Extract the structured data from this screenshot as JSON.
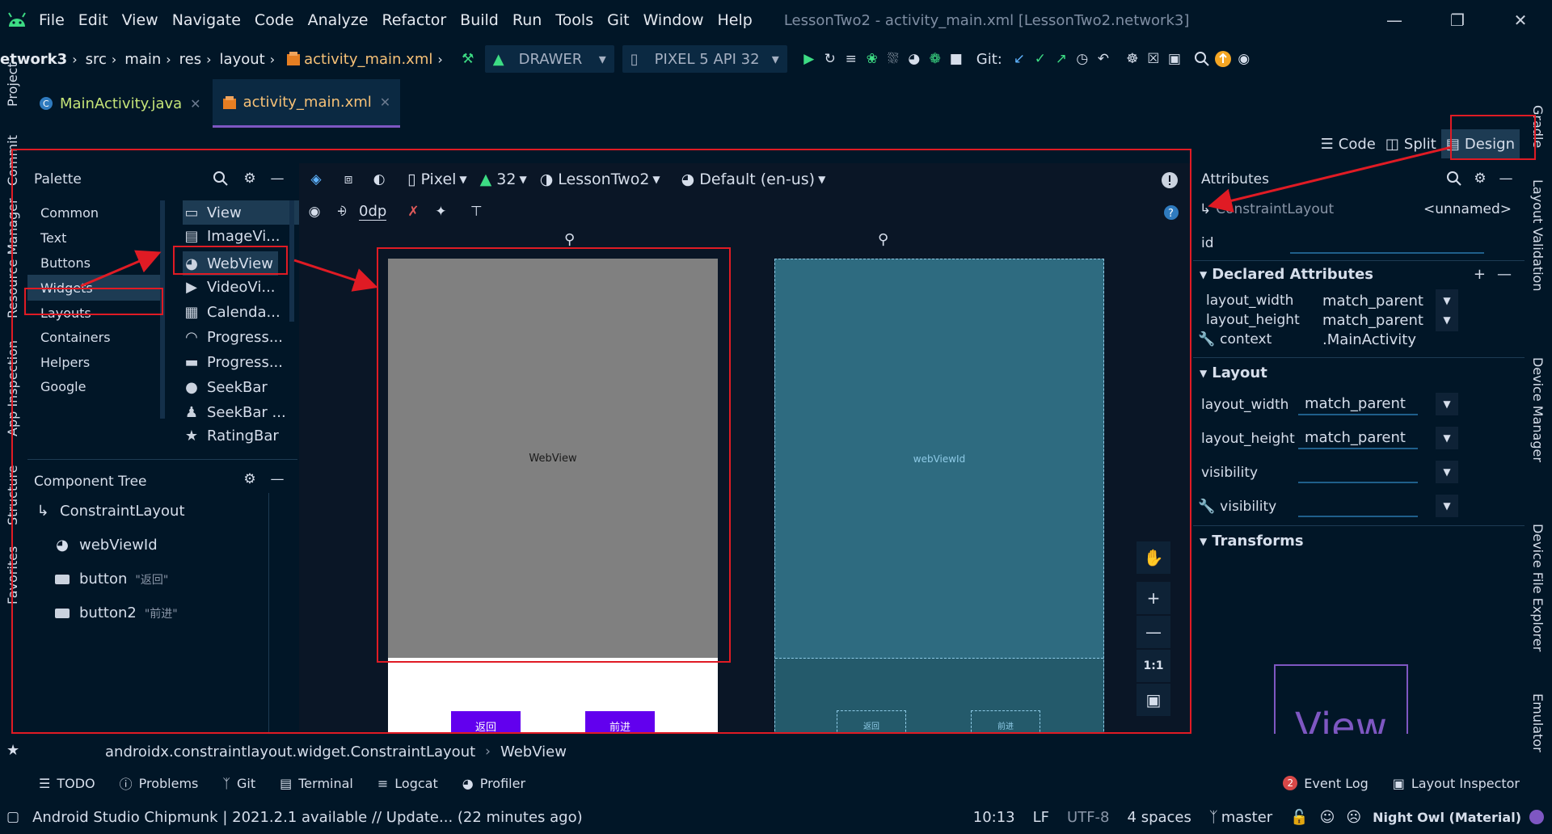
{
  "menu": {
    "items": [
      "File",
      "Edit",
      "View",
      "Navigate",
      "Code",
      "Analyze",
      "Refactor",
      "Build",
      "Run",
      "Tools",
      "Git",
      "Window",
      "Help"
    ],
    "window_title": "LessonTwo2 - activity_main.xml [LessonTwo2.network3]"
  },
  "nav": {
    "breadcrumbs": [
      "etwork3",
      "src",
      "main",
      "res",
      "layout",
      "activity_main.xml"
    ],
    "config_combo": "DRAWER",
    "device_combo": "PIXEL 5 API 32",
    "git_label": "Git:"
  },
  "tabs": [
    {
      "label": "MainActivity.java",
      "active": false
    },
    {
      "label": "activity_main.xml",
      "active": true
    }
  ],
  "left_strip": [
    "Project",
    "Commit",
    "Resource Manager",
    "App Inspection",
    "Structure",
    "Favorites"
  ],
  "right_strip": [
    "Gradle",
    "Layout Validation",
    "Device Manager",
    "Device File Explorer",
    "Emulator"
  ],
  "view_modes": {
    "code": "Code",
    "split": "Split",
    "design": "Design",
    "active": "Design"
  },
  "palette": {
    "title": "Palette",
    "categories": [
      "Common",
      "Text",
      "Buttons",
      "Widgets",
      "Layouts",
      "Containers",
      "Helpers",
      "Google"
    ],
    "selected_category": "Widgets",
    "widgets": [
      "View",
      "ImageVi...",
      "WebView",
      "VideoVi...",
      "Calenda...",
      "Progress...",
      "Progress...",
      "SeekBar",
      "SeekBar ...",
      "RatingBar"
    ],
    "selected_widget": "WebView"
  },
  "component_tree": {
    "title": "Component Tree",
    "nodes": [
      {
        "label": "ConstraintLayout",
        "hint": ""
      },
      {
        "label": "webViewId",
        "hint": ""
      },
      {
        "label": "button",
        "hint": "\"返回\""
      },
      {
        "label": "button2",
        "hint": "\"前进\""
      }
    ]
  },
  "surface": {
    "device": "Pixel",
    "api": "32",
    "theme": "LessonTwo2",
    "locale": "Default (en-us)",
    "margin": "0dp",
    "design_webview_label": "WebView",
    "blueprint_webview_label": "webViewId",
    "back_button": "返回",
    "forward_button": "前进",
    "zoom_fit": "1:1"
  },
  "attributes": {
    "title": "Attributes",
    "component": "ConstraintLayout",
    "component_name": "<unnamed>",
    "id_label": "id",
    "declared_title": "Declared Attributes",
    "declared": [
      {
        "name": "layout_width",
        "value": "match_parent"
      },
      {
        "name": "layout_height",
        "value": "match_parent"
      },
      {
        "name": "context",
        "value": ".MainActivity"
      }
    ],
    "layout_title": "Layout",
    "layout": [
      {
        "name": "layout_width",
        "value": "match_parent"
      },
      {
        "name": "layout_height",
        "value": "match_parent"
      },
      {
        "name": "visibility",
        "value": ""
      },
      {
        "name": "visibility",
        "value": ""
      }
    ],
    "transforms_title": "Transforms",
    "preview_label": "View"
  },
  "component_breadcrumb": [
    "androidx.constraintlayout.widget.ConstraintLayout",
    "WebView"
  ],
  "tool_windows": [
    "TODO",
    "Problems",
    "Git",
    "Terminal",
    "Logcat",
    "Profiler"
  ],
  "tool_windows_right": {
    "event_log": "Event Log",
    "event_count": "2",
    "layout_inspector": "Layout Inspector"
  },
  "status": {
    "message": "Android Studio Chipmunk | 2021.2.1 available // Update... (22 minutes ago)",
    "position": "10:13",
    "line_sep": "LF",
    "encoding": "UTF-8",
    "indent": "4 spaces",
    "branch": "master",
    "theme": "Night Owl (Material)"
  },
  "colors": {
    "accent": "#7e57c2",
    "annotation": "#e01b24",
    "button": "#6200ee",
    "background": "#011627"
  }
}
